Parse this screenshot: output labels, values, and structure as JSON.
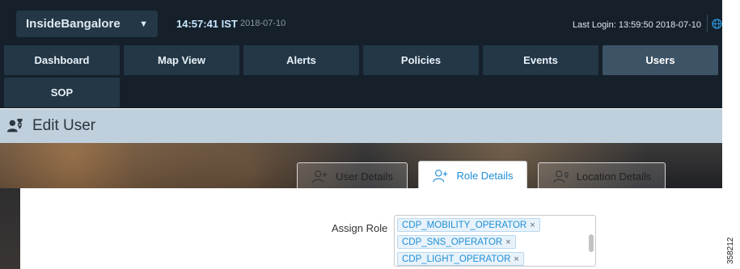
{
  "header": {
    "location": "InsideBangalore",
    "time": "14:57:41 IST",
    "date": "2018-07-10",
    "last_login": "Last Login: 13:59:50 2018-07-10"
  },
  "nav": {
    "tabs": [
      {
        "label": "Dashboard"
      },
      {
        "label": "Map View"
      },
      {
        "label": "Alerts"
      },
      {
        "label": "Policies"
      },
      {
        "label": "Events"
      },
      {
        "label": "Users",
        "active": true
      },
      {
        "label": "SOP"
      }
    ]
  },
  "page": {
    "title": "Edit User"
  },
  "subtabs": [
    {
      "label": "User Details"
    },
    {
      "label": "Role Details",
      "active": true
    },
    {
      "label": "Location Details"
    }
  ],
  "form": {
    "assign_role_label": "Assign Role",
    "roles": [
      "CDP_MOBILITY_OPERATOR",
      "CDP_SNS_OPERATOR",
      "CDP_LIGHT_OPERATOR"
    ],
    "remove_glyph": "×"
  },
  "figure_id": "358212",
  "colors": {
    "topbar_bg": "#15202b",
    "tab_bg": "#233746",
    "tab_active_bg": "#3d5366",
    "header_band": "#bfd0dc",
    "accent": "#1f8fd6"
  },
  "icons": [
    "caret-down-icon",
    "globe-icon",
    "user-location-icon",
    "user-details-icon",
    "role-details-icon",
    "location-details-icon",
    "remove-icon"
  ]
}
